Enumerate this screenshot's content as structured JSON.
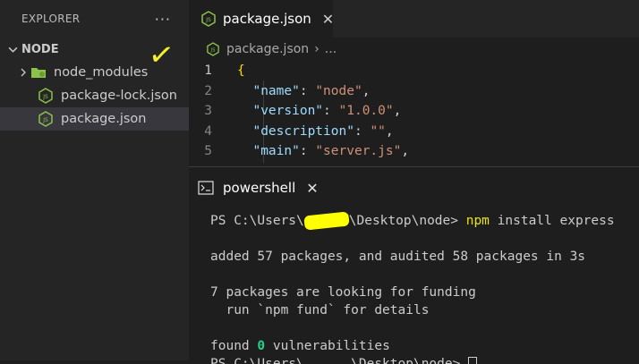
{
  "explorer": {
    "title": "EXPLORER",
    "more": "···",
    "folder": "NODE",
    "items": [
      {
        "label": "node_modules",
        "icon": "folder-icon",
        "type": "folder"
      },
      {
        "label": "package-lock.json",
        "icon": "nodejs-icon",
        "type": "file"
      },
      {
        "label": "package.json",
        "icon": "nodejs-icon",
        "type": "file",
        "selected": true
      }
    ]
  },
  "editor": {
    "tab_label": "package.json",
    "breadcrumb_file": "package.json",
    "breadcrumb_more": "...",
    "lines": [
      {
        "num": "1",
        "text": "{"
      },
      {
        "num": "2",
        "key": "\"name\"",
        "value": "\"node\""
      },
      {
        "num": "3",
        "key": "\"version\"",
        "value": "\"1.0.0\""
      },
      {
        "num": "4",
        "key": "\"description\"",
        "value": "\"\""
      },
      {
        "num": "5",
        "key": "\"main\"",
        "value": "\"server.js\""
      }
    ]
  },
  "panel": {
    "tab_label": "powershell",
    "prompt_prefix": "PS C:\\Users\\",
    "prompt_suffix": "\\Desktop\\node> ",
    "command": "npm",
    "command_args": " install express",
    "out1": "added 57 packages, and audited 58 packages in 3s",
    "out2": "7 packages are looking for funding",
    "out3": "  run `npm fund` for details",
    "out4_pre": "found ",
    "out4_num": "0",
    "out4_post": " vulnerabilities",
    "partial": "PS C:\\Users\\      \\Desktop\\node> "
  },
  "colors": {
    "accent_yellow": "#ffff00",
    "js_green": "#8bc34a"
  }
}
